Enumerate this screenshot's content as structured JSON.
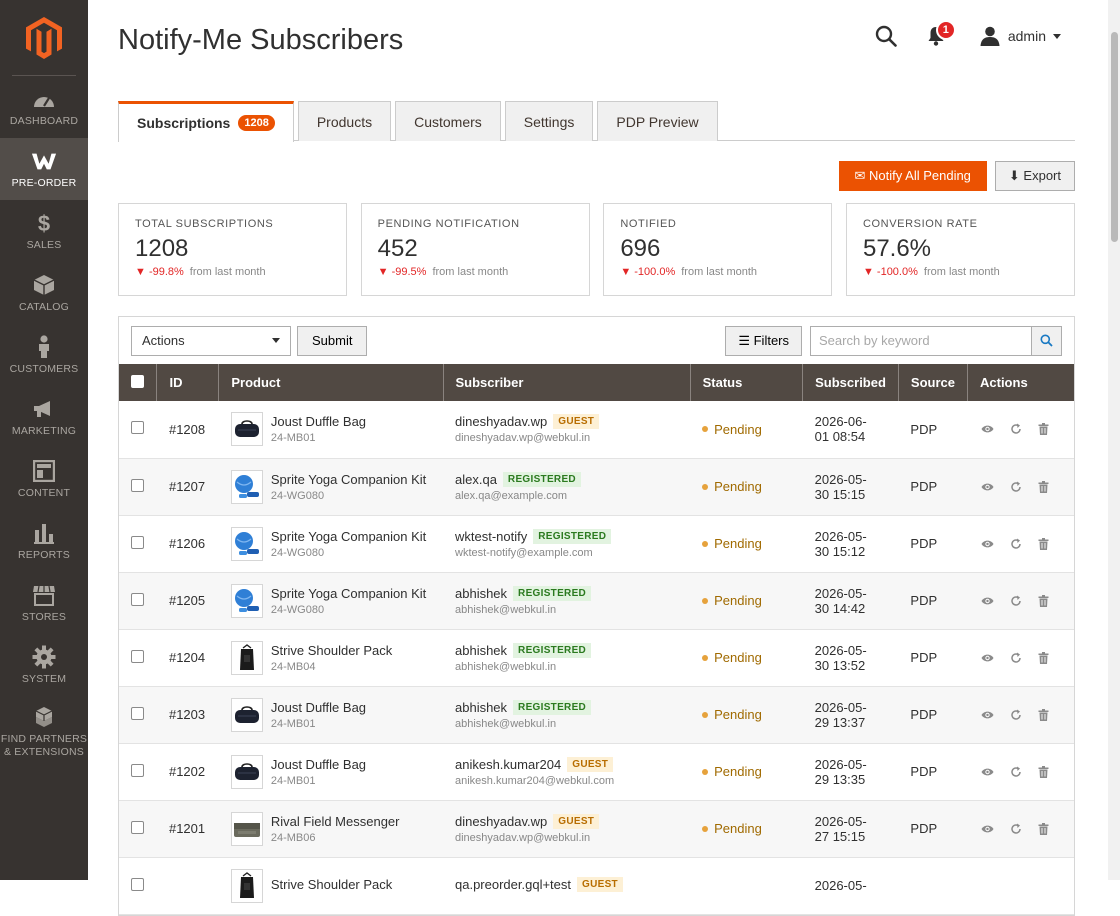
{
  "sidebar": {
    "items": [
      {
        "label": "DASHBOARD",
        "icon": "dashboard-icon"
      },
      {
        "label": "PRE-ORDER",
        "icon": "preorder-icon"
      },
      {
        "label": "SALES",
        "icon": "dollar-icon"
      },
      {
        "label": "CATALOG",
        "icon": "box-icon"
      },
      {
        "label": "CUSTOMERS",
        "icon": "person-icon"
      },
      {
        "label": "MARKETING",
        "icon": "megaphone-icon"
      },
      {
        "label": "CONTENT",
        "icon": "layout-icon"
      },
      {
        "label": "REPORTS",
        "icon": "bar-chart-icon"
      },
      {
        "label": "STORES",
        "icon": "store-icon"
      },
      {
        "label": "SYSTEM",
        "icon": "gear-icon"
      },
      {
        "label": "FIND PARTNERS & EXTENSIONS",
        "icon": "boxes-icon"
      }
    ]
  },
  "header": {
    "title": "Notify-Me Subscribers",
    "notifications": "1",
    "user": "admin"
  },
  "tabs": [
    {
      "label": "Subscriptions",
      "count": "1208"
    },
    {
      "label": "Products"
    },
    {
      "label": "Customers"
    },
    {
      "label": "Settings"
    },
    {
      "label": "PDP Preview"
    }
  ],
  "actions": {
    "notify_all": "✉ Notify All Pending",
    "export": "⬇ Export"
  },
  "stats": [
    {
      "label": "TOTAL SUBSCRIPTIONS",
      "value": "1208",
      "delta": "▼ -99.8%",
      "note": "from last month"
    },
    {
      "label": "PENDING NOTIFICATION",
      "value": "452",
      "delta": "▼ -99.5%",
      "note": "from last month"
    },
    {
      "label": "NOTIFIED",
      "value": "696",
      "delta": "▼ -100.0%",
      "note": "from last month"
    },
    {
      "label": "CONVERSION RATE",
      "value": "57.6%",
      "delta": "▼ -100.0%",
      "note": "from last month"
    }
  ],
  "toolbar": {
    "actions_select": "Actions",
    "submit": "Submit",
    "filters": "☰ Filters",
    "search_placeholder": "Search by keyword"
  },
  "columns": [
    "ID",
    "Product",
    "Subscriber",
    "Status",
    "Subscribed",
    "Source",
    "Actions"
  ],
  "rows": [
    {
      "id": "#1208",
      "product": "Joust Duffle Bag",
      "sku": "24-MB01",
      "thumb": "duffle",
      "subscriber": "dineshyadav.wp",
      "tag": "GUEST",
      "email": "dineshyadav.wp@webkul.in",
      "status": "Pending",
      "date1": "2026-06-",
      "date2": "01 08:54",
      "source": "PDP"
    },
    {
      "id": "#1207",
      "product": "Sprite Yoga Companion Kit",
      "sku": "24-WG080",
      "thumb": "yoga",
      "subscriber": "alex.qa",
      "tag": "REGISTERED",
      "email": "alex.qa@example.com",
      "status": "Pending",
      "date1": "2026-05-",
      "date2": "30 15:15",
      "source": "PDP"
    },
    {
      "id": "#1206",
      "product": "Sprite Yoga Companion Kit",
      "sku": "24-WG080",
      "thumb": "yoga",
      "subscriber": "wktest-notify",
      "tag": "REGISTERED",
      "email": "wktest-notify@example.com",
      "status": "Pending",
      "date1": "2026-05-",
      "date2": "30 15:12",
      "source": "PDP"
    },
    {
      "id": "#1205",
      "product": "Sprite Yoga Companion Kit",
      "sku": "24-WG080",
      "thumb": "yoga",
      "subscriber": "abhishek",
      "tag": "REGISTERED",
      "email": "abhishek@webkul.in",
      "status": "Pending",
      "date1": "2026-05-",
      "date2": "30 14:42",
      "source": "PDP"
    },
    {
      "id": "#1204",
      "product": "Strive Shoulder Pack",
      "sku": "24-MB04",
      "thumb": "pack",
      "subscriber": "abhishek",
      "tag": "REGISTERED",
      "email": "abhishek@webkul.in",
      "status": "Pending",
      "date1": "2026-05-",
      "date2": "30 13:52",
      "source": "PDP"
    },
    {
      "id": "#1203",
      "product": "Joust Duffle Bag",
      "sku": "24-MB01",
      "thumb": "duffle",
      "subscriber": "abhishek",
      "tag": "REGISTERED",
      "email": "abhishek@webkul.in",
      "status": "Pending",
      "date1": "2026-05-",
      "date2": "29 13:37",
      "source": "PDP"
    },
    {
      "id": "#1202",
      "product": "Joust Duffle Bag",
      "sku": "24-MB01",
      "thumb": "duffle",
      "subscriber": "anikesh.kumar204",
      "tag": "GUEST",
      "email": "anikesh.kumar204@webkul.com",
      "status": "Pending",
      "date1": "2026-05-",
      "date2": "29 13:35",
      "source": "PDP"
    },
    {
      "id": "#1201",
      "product": "Rival Field Messenger",
      "sku": "24-MB06",
      "thumb": "messenger",
      "subscriber": "dineshyadav.wp",
      "tag": "GUEST",
      "email": "dineshyadav.wp@webkul.in",
      "status": "Pending",
      "date1": "2026-05-",
      "date2": "27 15:15",
      "source": "PDP"
    },
    {
      "id": "",
      "product": "Strive Shoulder Pack",
      "sku": "",
      "thumb": "pack",
      "subscriber": "qa.preorder.gql+test",
      "tag": "GUEST",
      "email": "",
      "status": "",
      "date1": "2026-05-",
      "date2": "",
      "source": ""
    }
  ],
  "colors": {
    "accent": "#eb5202",
    "sidebar": "#373330",
    "table_header": "#514943"
  }
}
